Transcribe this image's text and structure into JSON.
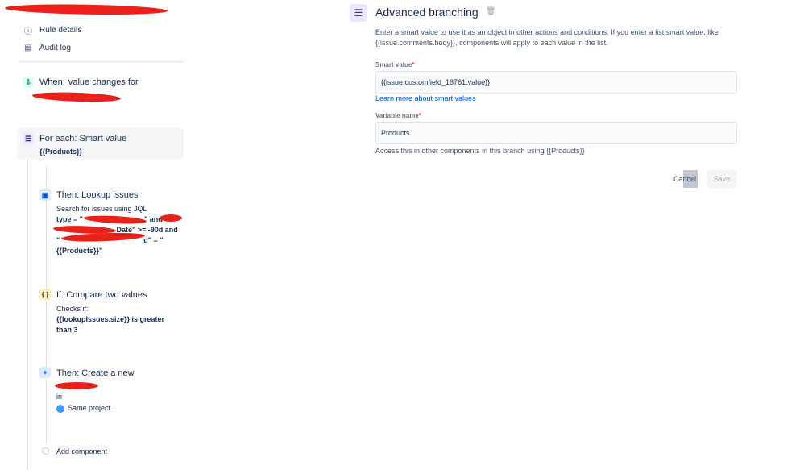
{
  "sidebar": {
    "rule_details": "Rule details",
    "audit_log": "Audit log"
  },
  "flow": {
    "trigger": {
      "title": "When: Value changes for"
    },
    "foreach": {
      "title": "For each: Smart value",
      "value": "{{Products}}"
    },
    "lookup": {
      "title": "Then: Lookup issues",
      "subtitle": "Search for issues using JQL",
      "jql_line1_start": "type = \"",
      "jql_line1_mid": "\" and \"",
      "jql_line2_end": " Date\" >= -90d and",
      "jql_line3_start": "\"",
      "jql_line3_mid": "d\" = \"",
      "jql_line4": "{{Products}}\""
    },
    "compare": {
      "title": "If: Compare two values",
      "subtitle": "Checks if:",
      "expr_line1": "{{lookupIssues.size}} is greater",
      "expr_line2": "than 3"
    },
    "create": {
      "title": "Then: Create a new",
      "in": "in",
      "project": "Same project"
    },
    "add_component": "Add component"
  },
  "panel": {
    "title": "Advanced branching",
    "description": "Enter a smart value to use it as an object in other actions and conditions. If you enter a list smart value, like {{issue.comments.body}}, components will apply to each value in the list.",
    "smart_value_label": "Smart value",
    "smart_value": "{{issue.customfield_18761.value}}",
    "learn_more": "Learn more about smart values",
    "variable_name_label": "Variable name",
    "variable_name": "Products",
    "helper": "Access this in other components in this branch using {{Products}}",
    "required_mark": "*",
    "cancel": "Cancel",
    "save": "Save"
  }
}
